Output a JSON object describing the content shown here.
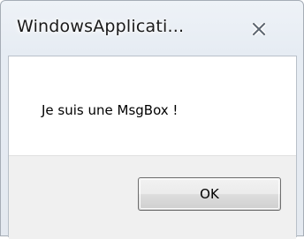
{
  "window": {
    "title": "WindowsApplicati...",
    "close_icon": "close-x-icon"
  },
  "dialog": {
    "message": "Je suis une MsgBox !",
    "ok_label": "OK"
  },
  "colors": {
    "frame": "#e6ecf3",
    "client_background": "#ffffff",
    "footer_background": "#f0f0f0",
    "button_border": "#707070"
  }
}
